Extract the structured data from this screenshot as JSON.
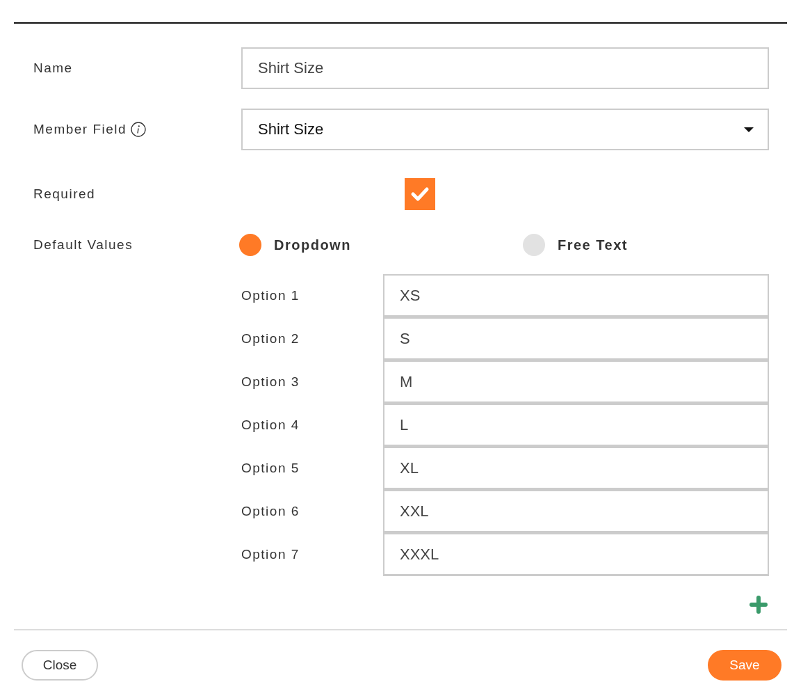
{
  "name_field": {
    "label": "Name",
    "value": "Shirt Size"
  },
  "member_field": {
    "label": "Member Field",
    "value": "Shirt Size"
  },
  "required": {
    "label": "Required",
    "checked": true
  },
  "default_values": {
    "label": "Default Values",
    "modes": [
      {
        "label": "Dropdown",
        "selected": true
      },
      {
        "label": "Free Text",
        "selected": false
      }
    ]
  },
  "options": [
    {
      "label": "Option 1",
      "value": "XS"
    },
    {
      "label": "Option 2",
      "value": "S"
    },
    {
      "label": "Option 3",
      "value": "M"
    },
    {
      "label": "Option 4",
      "value": "L"
    },
    {
      "label": "Option 5",
      "value": "XL"
    },
    {
      "label": "Option 6",
      "value": "XXL"
    },
    {
      "label": "Option 7",
      "value": "XXXL"
    }
  ],
  "buttons": {
    "close": "Close",
    "save": "Save"
  }
}
